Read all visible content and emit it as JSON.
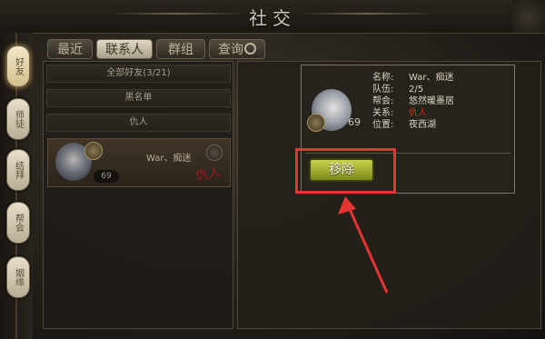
{
  "header": {
    "title": "社交"
  },
  "sidebar": {
    "tabs": [
      {
        "label": "好友"
      },
      {
        "label": "师徒"
      },
      {
        "label": "结拜"
      },
      {
        "label": "帮会"
      },
      {
        "label": "姻缘"
      }
    ]
  },
  "tabs": [
    {
      "label": "最近"
    },
    {
      "label": "联系人"
    },
    {
      "label": "群组"
    },
    {
      "label": "查询"
    }
  ],
  "groups": [
    {
      "label": "全部好友(3/21)"
    },
    {
      "label": "黑名单"
    },
    {
      "label": "仇人"
    }
  ],
  "friend": {
    "name": "War、痴迷",
    "level": "69",
    "seal": "仇人"
  },
  "info": {
    "level": "69",
    "name_key": "名称:",
    "name_val": "War、痴迷",
    "team_key": "队伍:",
    "team_val": "2/5",
    "guild_key": "帮会:",
    "guild_val": "悠然暖墨居",
    "relation_key": "关系:",
    "relation_val": "仇人",
    "location_key": "位置:",
    "location_val": "夜西湖"
  },
  "remove_button": {
    "label": "移除"
  },
  "colors": {
    "highlight": "#e53434",
    "button": "#a8b32c",
    "relation": "#e3241d"
  }
}
